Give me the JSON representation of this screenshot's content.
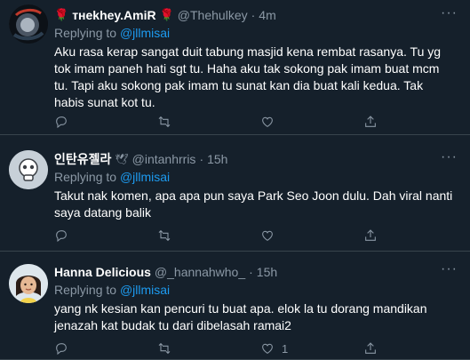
{
  "tweets": [
    {
      "name": "ᴛʜekhey.AmiR",
      "name_prefix_emoji": "🌹",
      "name_suffix_emoji": "🌹",
      "handle": "@Thehulkey",
      "time": "4m",
      "reply_label": "Replying to",
      "reply_handle": "@jllmisai",
      "text": "Aku rasa kerap sangat duit tabung masjid kena rembat rasanya. Tu yg tok imam paneh hati sgt tu. Haha aku tak sokong pak imam buat mcm tu. Tapi aku sokong pak imam tu sunat kan dia buat kali kedua. Tak habis sunat kot tu.",
      "like_count": ""
    },
    {
      "name": "인탄유젤라",
      "name_suffix_emoji": "🕊",
      "handle": "@intanhrris",
      "time": "15h",
      "reply_label": "Replying to",
      "reply_handle": "@jllmisai",
      "text": "Takut nak komen, apa apa pun saya Park Seo Joon dulu. Dah viral nanti saya datang balik",
      "like_count": ""
    },
    {
      "name": "Hanna Delicious",
      "handle": "@_hannahwho_",
      "time": "15h",
      "reply_label": "Replying to",
      "reply_handle": "@jllmisai",
      "text": "yang nk kesian kan pencuri tu buat apa. elok la tu dorang mandikan jenazah kat budak tu dari dibelasah ramai2",
      "like_count": "1"
    }
  ],
  "separator": "·",
  "more_glyph": "···",
  "icons": {
    "reply": "reply-icon",
    "retweet": "retweet-icon",
    "like": "like-icon",
    "share": "share-icon",
    "more": "more-icon"
  },
  "colors": {
    "background": "#15202b",
    "text": "#ffffff",
    "muted": "#8b98a5",
    "link": "#1d9bf0",
    "divider": "#38444d"
  }
}
